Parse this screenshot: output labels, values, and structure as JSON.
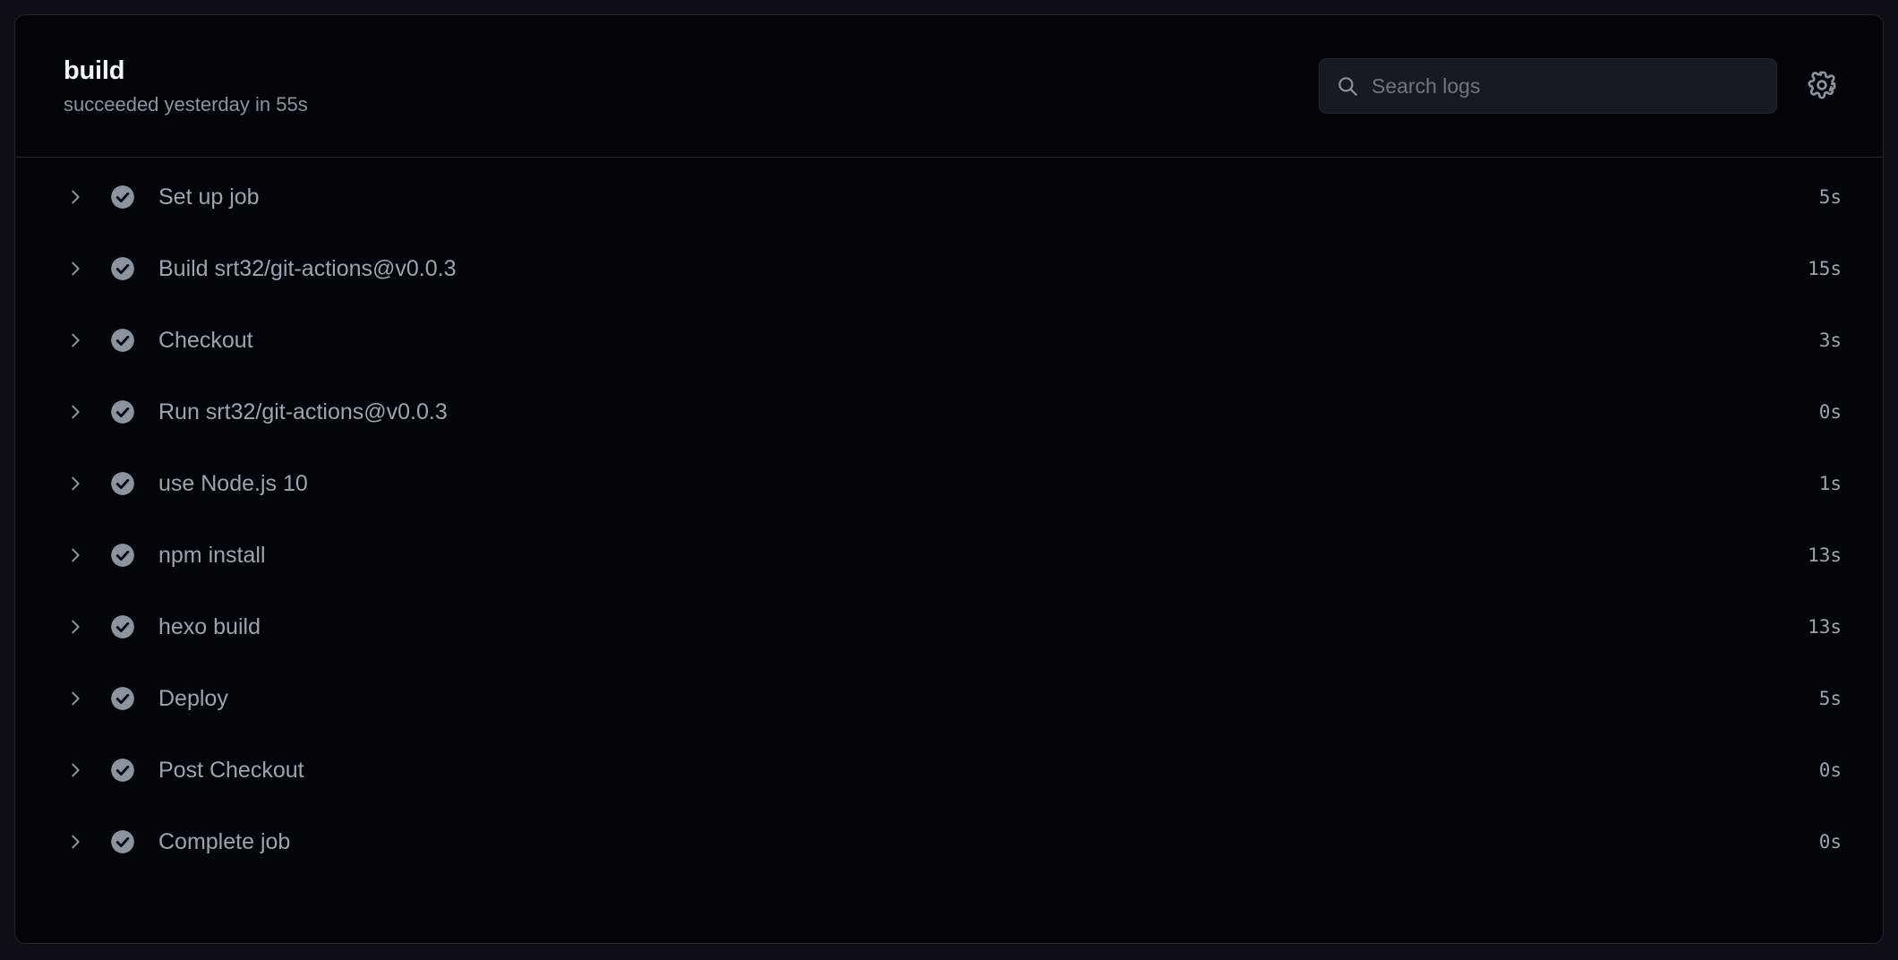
{
  "header": {
    "title": "build",
    "subtitle": "succeeded yesterday in 55s",
    "search": {
      "placeholder": "Search logs",
      "value": "",
      "icon": "search-icon"
    },
    "settings": {
      "icon": "gear-icon",
      "label": "Settings"
    }
  },
  "colors": {
    "page_background": "#0d1117",
    "card_background": "#010409",
    "border": "#21262d",
    "title_text": "#f0f6fc",
    "muted_text": "#8b949e",
    "step_text": "#9ba4af",
    "search_background": "#161b22",
    "status_success": "#8b949e"
  },
  "steps": [
    {
      "label": "Set up job",
      "duration": "5s",
      "status": "succeeded",
      "status_icon": "check-circle-icon",
      "expand_icon": "chevron-right-icon"
    },
    {
      "label": "Build srt32/git-actions@v0.0.3",
      "duration": "15s",
      "status": "succeeded",
      "status_icon": "check-circle-icon",
      "expand_icon": "chevron-right-icon"
    },
    {
      "label": "Checkout",
      "duration": "3s",
      "status": "succeeded",
      "status_icon": "check-circle-icon",
      "expand_icon": "chevron-right-icon"
    },
    {
      "label": "Run srt32/git-actions@v0.0.3",
      "duration": "0s",
      "status": "succeeded",
      "status_icon": "check-circle-icon",
      "expand_icon": "chevron-right-icon"
    },
    {
      "label": "use Node.js 10",
      "duration": "1s",
      "status": "succeeded",
      "status_icon": "check-circle-icon",
      "expand_icon": "chevron-right-icon"
    },
    {
      "label": "npm install",
      "duration": "13s",
      "status": "succeeded",
      "status_icon": "check-circle-icon",
      "expand_icon": "chevron-right-icon"
    },
    {
      "label": "hexo build",
      "duration": "13s",
      "status": "succeeded",
      "status_icon": "check-circle-icon",
      "expand_icon": "chevron-right-icon"
    },
    {
      "label": "Deploy",
      "duration": "5s",
      "status": "succeeded",
      "status_icon": "check-circle-icon",
      "expand_icon": "chevron-right-icon"
    },
    {
      "label": "Post Checkout",
      "duration": "0s",
      "status": "succeeded",
      "status_icon": "check-circle-icon",
      "expand_icon": "chevron-right-icon"
    },
    {
      "label": "Complete job",
      "duration": "0s",
      "status": "succeeded",
      "status_icon": "check-circle-icon",
      "expand_icon": "chevron-right-icon"
    }
  ]
}
